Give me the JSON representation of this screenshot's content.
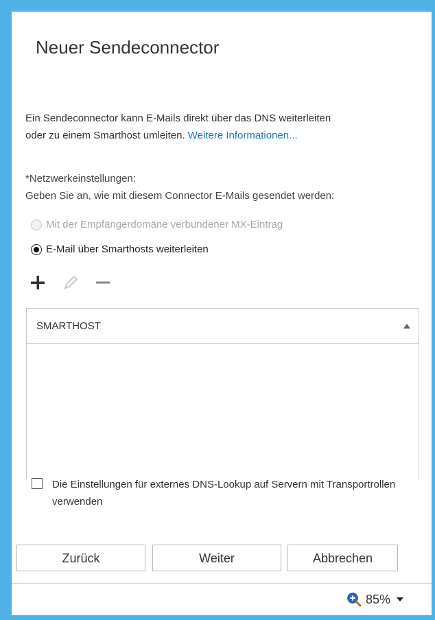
{
  "dialog": {
    "title": "Neuer Sendeconnector",
    "description_line1": "Ein Sendeconnector kann E-Mails direkt über das DNS weiterleiten",
    "description_line2": "oder zu einem Smarthost umleiten.",
    "more_info_link": "Weitere Informationen..."
  },
  "network": {
    "label": "*Netzwerkeinstellungen:",
    "description": "Geben Sie an, wie mit diesem Connector E-Mails gesendet werden:",
    "options": [
      {
        "label": "Mit der Empfängerdomäne verbundener MX-Eintrag",
        "checked": false,
        "disabled": true
      },
      {
        "label": "E-Mail über Smarthosts weiterleiten",
        "checked": true,
        "disabled": false
      }
    ]
  },
  "toolbar": {
    "icons": [
      "plus-icon",
      "pencil-icon",
      "minus-icon"
    ]
  },
  "grid": {
    "column_header": "SMARTHOST",
    "rows": []
  },
  "dns_checkbox": {
    "label": "Die Einstellungen für externes DNS-Lookup auf Servern mit Transportrollen verwenden",
    "checked": false
  },
  "buttons": {
    "back": "Zurück",
    "next": "Weiter",
    "cancel": "Abbrechen"
  },
  "status": {
    "zoom": "85%"
  },
  "colors": {
    "link": "#1a73c9",
    "frame": "#4fb3e6"
  }
}
